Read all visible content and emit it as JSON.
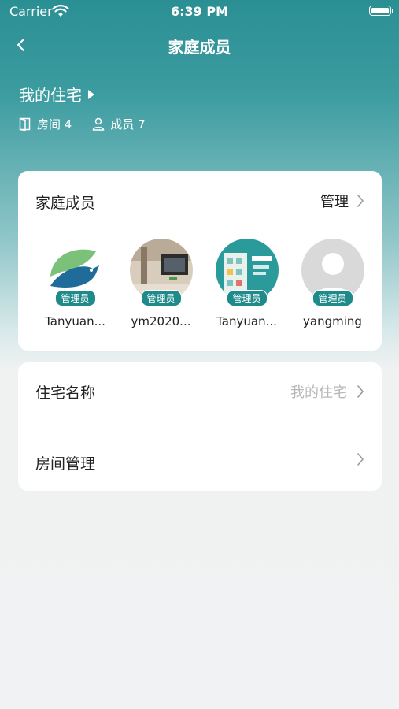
{
  "status": {
    "carrier": "Carrier",
    "time": "6:39 PM"
  },
  "nav": {
    "title": "家庭成员"
  },
  "home": {
    "name": "我的住宅",
    "rooms_label": "房间 4",
    "members_label": "成员 7"
  },
  "members_card": {
    "title": "家庭成员",
    "manage_label": "管理",
    "members": [
      {
        "name": "Tanyuan...",
        "badge": "管理员",
        "avatar": "bird-logo"
      },
      {
        "name": "ym2020...",
        "badge": "管理员",
        "avatar": "room-photo"
      },
      {
        "name": "Tanyuan...",
        "badge": "管理员",
        "avatar": "building-photo"
      },
      {
        "name": "yangming",
        "badge": "管理员",
        "avatar": "default-person"
      }
    ]
  },
  "settings": {
    "home_name_label": "住宅名称",
    "home_name_value": "我的住宅",
    "room_manage_label": "房间管理"
  },
  "colors": {
    "accent": "#1e8a8a",
    "header_top": "#2a8f93",
    "background": "#f1f2f3"
  }
}
